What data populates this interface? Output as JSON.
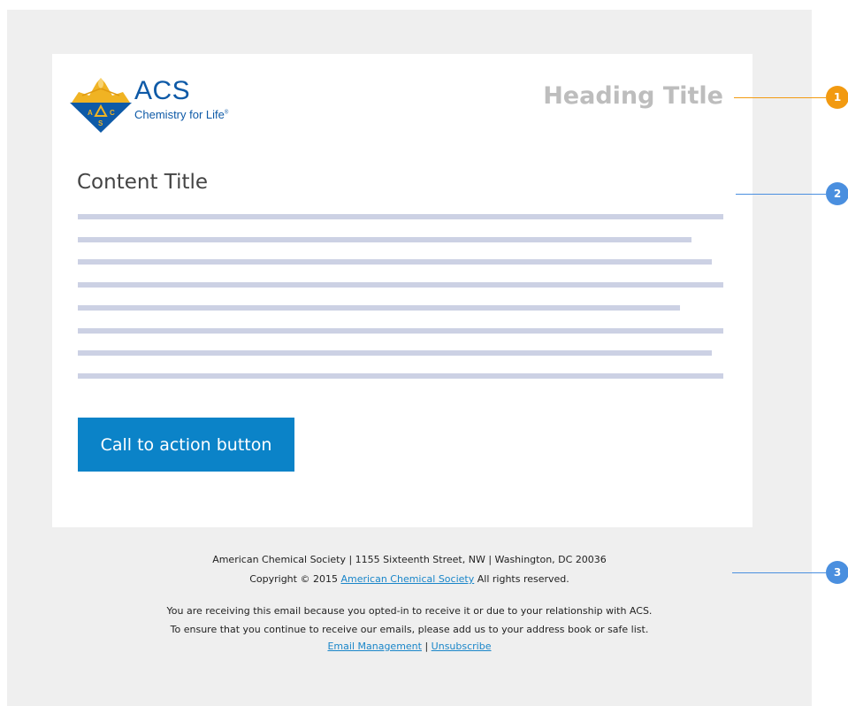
{
  "logo": {
    "name": "ACS",
    "tagline": "Chemistry for Life",
    "trademark": "®",
    "emblem_letters": [
      "A",
      "C",
      "S"
    ]
  },
  "header": {
    "heading_title": "Heading Title"
  },
  "content": {
    "title": "Content Title",
    "cta_label": "Call to action button"
  },
  "footer": {
    "address": "American Chemical Society | 1155 Sixteenth Street, NW | Washington, DC 20036",
    "copyright_prefix": "Copyright © 2015 ",
    "copyright_link": "American Chemical Society",
    "copyright_suffix": " All rights reserved.",
    "notice_1": "You are receiving this email because you opted-in to receive it or due to your relationship with ACS.",
    "notice_2": "To ensure that you continue to receive our emails, please add us to your address book or safe list.",
    "link_email_management": "Email Management",
    "separator": " | ",
    "link_unsubscribe": "Unsubscribe"
  },
  "callouts": [
    {
      "number": "1",
      "color": "#f29a11"
    },
    {
      "number": "2",
      "color": "#4a8fdf"
    },
    {
      "number": "3",
      "color": "#4a8fdf"
    }
  ],
  "colors": {
    "accent": "#0b83c8",
    "logo_blue": "#0e5aa7",
    "logo_gold": "#f0b323",
    "placeholder_line": "#ccd1e4"
  }
}
